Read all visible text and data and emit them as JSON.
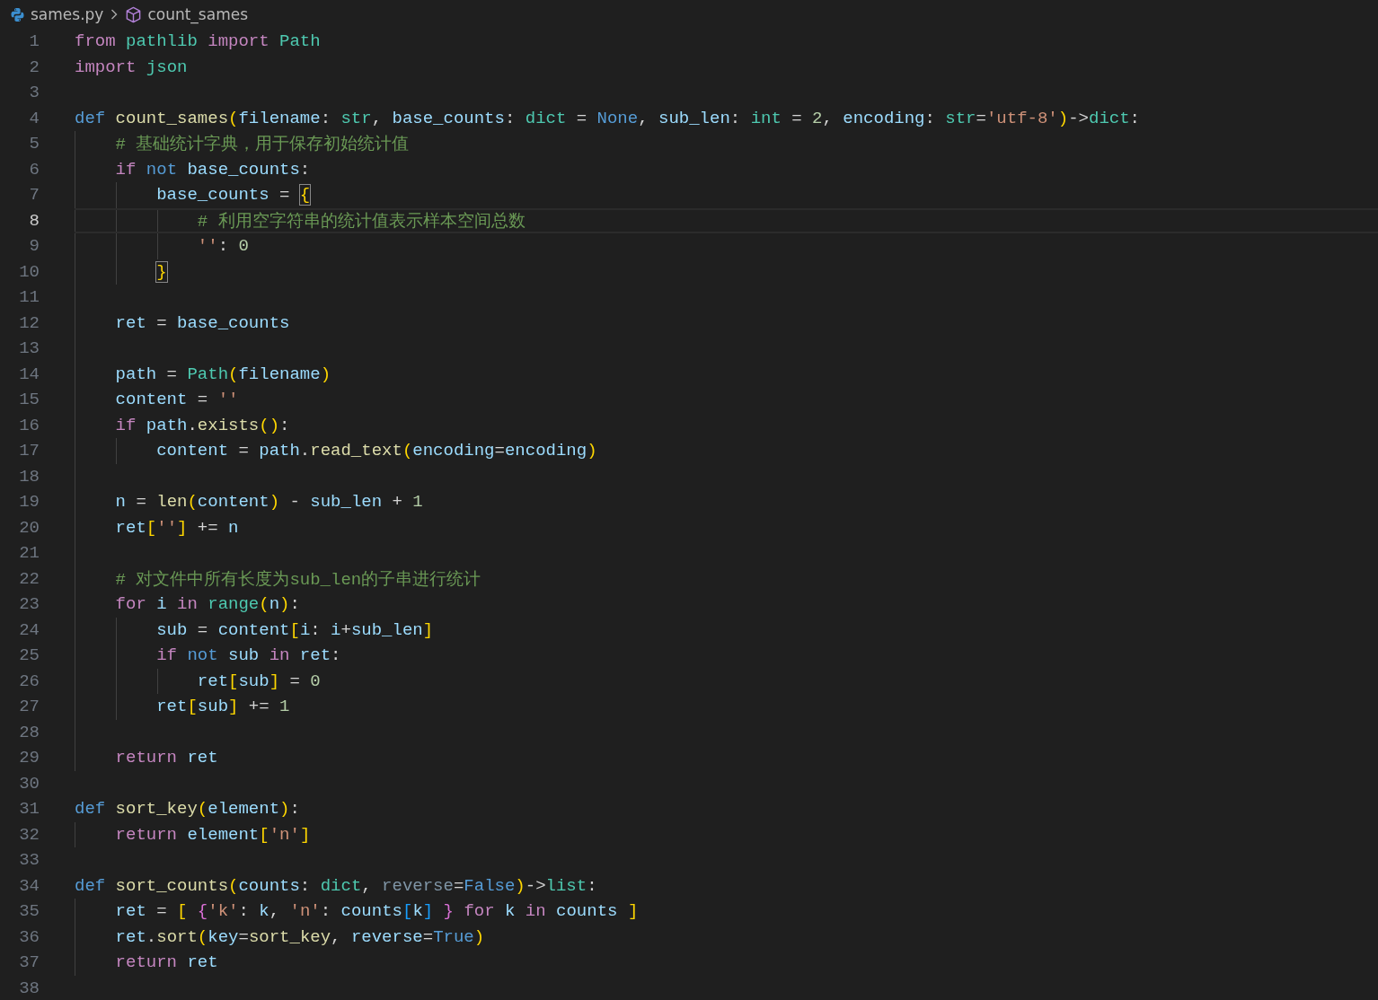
{
  "breadcrumbs": {
    "file": "sames.py",
    "symbol": "count_sames"
  },
  "lines": [
    {
      "number": "1",
      "current": false,
      "tokens": [
        {
          "text": "from ",
          "kind": "kw"
        },
        {
          "text": "pathlib ",
          "kind": "cls"
        },
        {
          "text": "import ",
          "kind": "kw"
        },
        {
          "text": "Path",
          "kind": "cls"
        }
      ]
    },
    {
      "number": "2",
      "current": false,
      "tokens": [
        {
          "text": "import ",
          "kind": "kw"
        },
        {
          "text": "json",
          "kind": "cls"
        }
      ]
    },
    {
      "number": "3",
      "current": false
    },
    {
      "number": "4",
      "current": false,
      "tokens": [
        {
          "text": "def ",
          "kind": "st"
        },
        {
          "text": "count_sames",
          "kind": "fn"
        },
        {
          "text": "(",
          "kind": "b1"
        },
        {
          "text": "filename",
          "kind": "var"
        },
        {
          "text": ": ",
          "kind": "op"
        },
        {
          "text": "str",
          "kind": "cls"
        },
        {
          "text": ", ",
          "kind": "op"
        },
        {
          "text": "base_counts",
          "kind": "var"
        },
        {
          "text": ": ",
          "kind": "op"
        },
        {
          "text": "dict",
          "kind": "cls"
        },
        {
          "text": " = ",
          "kind": "op"
        },
        {
          "text": "None",
          "kind": "st"
        },
        {
          "text": ", ",
          "kind": "op"
        },
        {
          "text": "sub_len",
          "kind": "var"
        },
        {
          "text": ": ",
          "kind": "op"
        },
        {
          "text": "int",
          "kind": "cls"
        },
        {
          "text": " = ",
          "kind": "op"
        },
        {
          "text": "2",
          "kind": "num"
        },
        {
          "text": ", ",
          "kind": "op"
        },
        {
          "text": "encoding",
          "kind": "var"
        },
        {
          "text": ": ",
          "kind": "op"
        },
        {
          "text": "str",
          "kind": "cls"
        },
        {
          "text": "=",
          "kind": "op"
        },
        {
          "text": "'utf-8'",
          "kind": "str"
        },
        {
          "text": ")",
          "kind": "b1"
        },
        {
          "text": "->",
          "kind": "op"
        },
        {
          "text": "dict",
          "kind": "cls"
        },
        {
          "text": ":",
          "kind": "op"
        }
      ]
    },
    {
      "number": "5",
      "current": false,
      "tokens": [
        {
          "text": "    # 基础统计字典，用于保存初始统计值",
          "kind": "com"
        }
      ]
    },
    {
      "number": "6",
      "current": false,
      "tokens": [
        {
          "text": "    if ",
          "kind": "kw"
        },
        {
          "text": "not ",
          "kind": "st"
        },
        {
          "text": "base_counts",
          "kind": "var"
        },
        {
          "text": ":",
          "kind": "op"
        }
      ]
    },
    {
      "number": "7",
      "current": false,
      "tokens": [
        {
          "text": "        base_counts",
          "kind": "var"
        },
        {
          "text": " = ",
          "kind": "op"
        },
        {
          "text": "{",
          "kind": "match"
        }
      ]
    },
    {
      "number": "8",
      "current": true,
      "tokens": [
        {
          "text": "            # 利用空字符串的统计值表示样本空间总数",
          "kind": "com"
        }
      ]
    },
    {
      "number": "9",
      "current": false,
      "tokens": [
        {
          "text": "            ''",
          "kind": "str"
        },
        {
          "text": ": ",
          "kind": "op"
        },
        {
          "text": "0",
          "kind": "num"
        }
      ]
    },
    {
      "number": "10",
      "current": false,
      "tokens": [
        {
          "text": "        }",
          "kind": "match"
        }
      ]
    },
    {
      "number": "11",
      "current": false
    },
    {
      "number": "12",
      "current": false,
      "tokens": [
        {
          "text": "    ret",
          "kind": "var"
        },
        {
          "text": " = ",
          "kind": "op"
        },
        {
          "text": "base_counts",
          "kind": "var"
        }
      ]
    },
    {
      "number": "13",
      "current": false
    },
    {
      "number": "14",
      "current": false,
      "tokens": [
        {
          "text": "    path",
          "kind": "var"
        },
        {
          "text": " = ",
          "kind": "op"
        },
        {
          "text": "Path",
          "kind": "cls"
        },
        {
          "text": "(",
          "kind": "b1"
        },
        {
          "text": "filename",
          "kind": "var"
        },
        {
          "text": ")",
          "kind": "b1"
        }
      ]
    },
    {
      "number": "15",
      "current": false,
      "tokens": [
        {
          "text": "    content",
          "kind": "var"
        },
        {
          "text": " = ",
          "kind": "op"
        },
        {
          "text": "''",
          "kind": "str"
        }
      ]
    },
    {
      "number": "16",
      "current": false,
      "tokens": [
        {
          "text": "    if ",
          "kind": "kw"
        },
        {
          "text": "path",
          "kind": "var"
        },
        {
          "text": ".",
          "kind": "op"
        },
        {
          "text": "exists",
          "kind": "fn"
        },
        {
          "text": "()",
          "kind": "b1"
        },
        {
          "text": ":",
          "kind": "op"
        }
      ]
    },
    {
      "number": "17",
      "current": false,
      "tokens": [
        {
          "text": "        content",
          "kind": "var"
        },
        {
          "text": " = ",
          "kind": "op"
        },
        {
          "text": "path",
          "kind": "var"
        },
        {
          "text": ".",
          "kind": "op"
        },
        {
          "text": "read_text",
          "kind": "fn"
        },
        {
          "text": "(",
          "kind": "b1"
        },
        {
          "text": "encoding",
          "kind": "var"
        },
        {
          "text": "=",
          "kind": "op"
        },
        {
          "text": "encoding",
          "kind": "var"
        },
        {
          "text": ")",
          "kind": "b1"
        }
      ]
    },
    {
      "number": "18",
      "current": false
    },
    {
      "number": "19",
      "current": false,
      "tokens": [
        {
          "text": "    n",
          "kind": "var"
        },
        {
          "text": " = ",
          "kind": "op"
        },
        {
          "text": "len",
          "kind": "fn"
        },
        {
          "text": "(",
          "kind": "b1"
        },
        {
          "text": "content",
          "kind": "var"
        },
        {
          "text": ")",
          "kind": "b1"
        },
        {
          "text": " - ",
          "kind": "op"
        },
        {
          "text": "sub_len",
          "kind": "var"
        },
        {
          "text": " + ",
          "kind": "op"
        },
        {
          "text": "1",
          "kind": "num"
        }
      ]
    },
    {
      "number": "20",
      "current": false,
      "tokens": [
        {
          "text": "    ret",
          "kind": "var"
        },
        {
          "text": "[",
          "kind": "b1"
        },
        {
          "text": "''",
          "kind": "str"
        },
        {
          "text": "]",
          "kind": "b1"
        },
        {
          "text": " += ",
          "kind": "op"
        },
        {
          "text": "n",
          "kind": "var"
        }
      ]
    },
    {
      "number": "21",
      "current": false
    },
    {
      "number": "22",
      "current": false,
      "tokens": [
        {
          "text": "    # 对文件中所有长度为sub_len的子串进行统计",
          "kind": "com"
        }
      ]
    },
    {
      "number": "23",
      "current": false,
      "tokens": [
        {
          "text": "    for ",
          "kind": "kw"
        },
        {
          "text": "i ",
          "kind": "var"
        },
        {
          "text": "in ",
          "kind": "kw"
        },
        {
          "text": "range",
          "kind": "cls"
        },
        {
          "text": "(",
          "kind": "b1"
        },
        {
          "text": "n",
          "kind": "var"
        },
        {
          "text": ")",
          "kind": "b1"
        },
        {
          "text": ":",
          "kind": "op"
        }
      ]
    },
    {
      "number": "24",
      "current": false,
      "tokens": [
        {
          "text": "        sub",
          "kind": "var"
        },
        {
          "text": " = ",
          "kind": "op"
        },
        {
          "text": "content",
          "kind": "var"
        },
        {
          "text": "[",
          "kind": "b1"
        },
        {
          "text": "i",
          "kind": "var"
        },
        {
          "text": ": ",
          "kind": "op"
        },
        {
          "text": "i",
          "kind": "var"
        },
        {
          "text": "+",
          "kind": "op"
        },
        {
          "text": "sub_len",
          "kind": "var"
        },
        {
          "text": "]",
          "kind": "b1"
        }
      ]
    },
    {
      "number": "25",
      "current": false,
      "tokens": [
        {
          "text": "        if ",
          "kind": "kw"
        },
        {
          "text": "not ",
          "kind": "st"
        },
        {
          "text": "sub ",
          "kind": "var"
        },
        {
          "text": "in ",
          "kind": "kw"
        },
        {
          "text": "ret",
          "kind": "var"
        },
        {
          "text": ":",
          "kind": "op"
        }
      ]
    },
    {
      "number": "26",
      "current": false,
      "tokens": [
        {
          "text": "            ret",
          "kind": "var"
        },
        {
          "text": "[",
          "kind": "b1"
        },
        {
          "text": "sub",
          "kind": "var"
        },
        {
          "text": "]",
          "kind": "b1"
        },
        {
          "text": " = ",
          "kind": "op"
        },
        {
          "text": "0",
          "kind": "num"
        }
      ]
    },
    {
      "number": "27",
      "current": false,
      "tokens": [
        {
          "text": "        ret",
          "kind": "var"
        },
        {
          "text": "[",
          "kind": "b1"
        },
        {
          "text": "sub",
          "kind": "var"
        },
        {
          "text": "]",
          "kind": "b1"
        },
        {
          "text": " += ",
          "kind": "op"
        },
        {
          "text": "1",
          "kind": "num"
        }
      ]
    },
    {
      "number": "28",
      "current": false
    },
    {
      "number": "29",
      "current": false,
      "tokens": [
        {
          "text": "    return ",
          "kind": "kw"
        },
        {
          "text": "ret",
          "kind": "var"
        }
      ]
    },
    {
      "number": "30",
      "current": false
    },
    {
      "number": "31",
      "current": false,
      "tokens": [
        {
          "text": "def ",
          "kind": "st"
        },
        {
          "text": "sort_key",
          "kind": "fn"
        },
        {
          "text": "(",
          "kind": "b1"
        },
        {
          "text": "element",
          "kind": "var"
        },
        {
          "text": ")",
          "kind": "b1"
        },
        {
          "text": ":",
          "kind": "op"
        }
      ]
    },
    {
      "number": "32",
      "current": false,
      "tokens": [
        {
          "text": "    return ",
          "kind": "kw"
        },
        {
          "text": "element",
          "kind": "var"
        },
        {
          "text": "[",
          "kind": "b1"
        },
        {
          "text": "'n'",
          "kind": "str"
        },
        {
          "text": "]",
          "kind": "b1"
        }
      ]
    },
    {
      "number": "33",
      "current": false
    },
    {
      "number": "34",
      "current": false,
      "tokens": [
        {
          "text": "def ",
          "kind": "st"
        },
        {
          "text": "sort_counts",
          "kind": "fn"
        },
        {
          "text": "(",
          "kind": "b1"
        },
        {
          "text": "counts",
          "kind": "var"
        },
        {
          "text": ": ",
          "kind": "op"
        },
        {
          "text": "dict",
          "kind": "cls"
        },
        {
          "text": ", ",
          "kind": "op"
        },
        {
          "text": "reverse",
          "kind": "unused"
        },
        {
          "text": "=",
          "kind": "op"
        },
        {
          "text": "False",
          "kind": "st"
        },
        {
          "text": ")",
          "kind": "b1"
        },
        {
          "text": "->",
          "kind": "op"
        },
        {
          "text": "list",
          "kind": "cls"
        },
        {
          "text": ":",
          "kind": "op"
        }
      ]
    },
    {
      "number": "35",
      "current": false,
      "tokens": [
        {
          "text": "    ret",
          "kind": "var"
        },
        {
          "text": " = ",
          "kind": "op"
        },
        {
          "text": "[ ",
          "kind": "b1"
        },
        {
          "text": "{",
          "kind": "b2"
        },
        {
          "text": "'k'",
          "kind": "str"
        },
        {
          "text": ": ",
          "kind": "op"
        },
        {
          "text": "k",
          "kind": "var"
        },
        {
          "text": ", ",
          "kind": "op"
        },
        {
          "text": "'n'",
          "kind": "str"
        },
        {
          "text": ": ",
          "kind": "op"
        },
        {
          "text": "counts",
          "kind": "var"
        },
        {
          "text": "[",
          "kind": "b3"
        },
        {
          "text": "k",
          "kind": "var"
        },
        {
          "text": "] ",
          "kind": "b3"
        },
        {
          "text": "} ",
          "kind": "b2"
        },
        {
          "text": "for ",
          "kind": "kw"
        },
        {
          "text": "k ",
          "kind": "var"
        },
        {
          "text": "in ",
          "kind": "kw"
        },
        {
          "text": "counts ",
          "kind": "var"
        },
        {
          "text": "]",
          "kind": "b1"
        }
      ]
    },
    {
      "number": "36",
      "current": false,
      "tokens": [
        {
          "text": "    ret",
          "kind": "var"
        },
        {
          "text": ".",
          "kind": "op"
        },
        {
          "text": "sort",
          "kind": "fn"
        },
        {
          "text": "(",
          "kind": "b1"
        },
        {
          "text": "key",
          "kind": "var"
        },
        {
          "text": "=",
          "kind": "op"
        },
        {
          "text": "sort_key",
          "kind": "fn"
        },
        {
          "text": ", ",
          "kind": "op"
        },
        {
          "text": "reverse",
          "kind": "var"
        },
        {
          "text": "=",
          "kind": "op"
        },
        {
          "text": "True",
          "kind": "st"
        },
        {
          "text": ")",
          "kind": "b1"
        }
      ]
    },
    {
      "number": "37",
      "current": false,
      "tokens": [
        {
          "text": "    return ",
          "kind": "kw"
        },
        {
          "text": "ret",
          "kind": "var"
        }
      ]
    },
    {
      "number": "38",
      "current": false
    }
  ]
}
